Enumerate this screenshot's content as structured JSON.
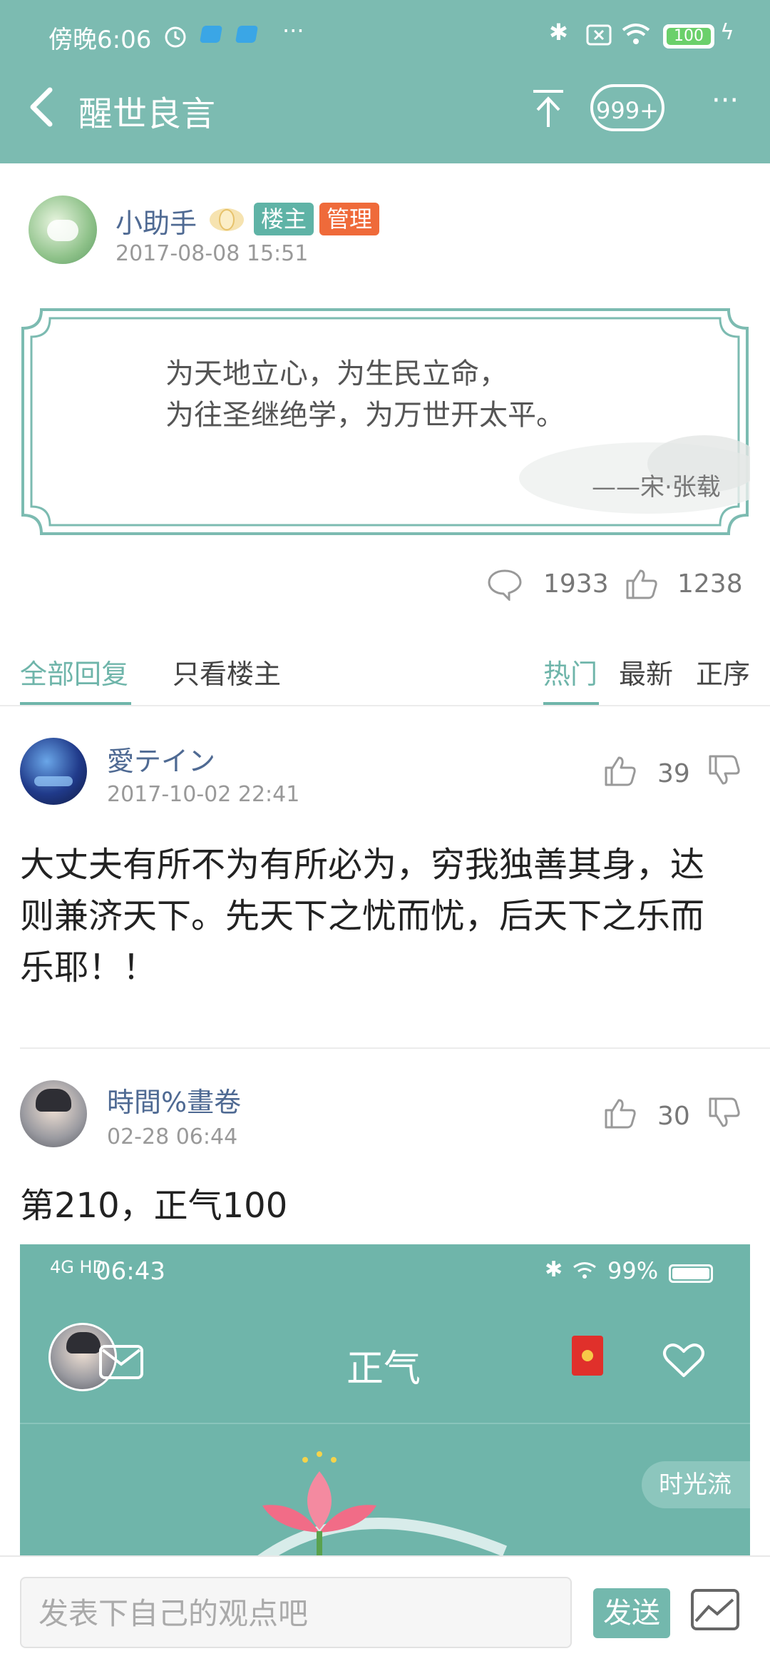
{
  "status_bar": {
    "time": "傍晚6:06",
    "battery": "100",
    "more": "···"
  },
  "header": {
    "title": "醒世良言",
    "bubble_count": "999+",
    "more": "···"
  },
  "post": {
    "author": "小助手",
    "badge_owner": "楼主",
    "badge_admin": "管理",
    "time": "2017-08-08 15:51",
    "quote_line1": "为天地立心，为生民立命，",
    "quote_line2": "为往圣继绝学，为万世开太平。",
    "quote_source": "——宋·张载",
    "comment_count": "1933",
    "like_count": "1238"
  },
  "tabs": {
    "all": "全部回复",
    "owner_only": "只看楼主",
    "hot": "热门",
    "latest": "最新",
    "order": "正序"
  },
  "comments": [
    {
      "author": "愛テイン",
      "time": "2017-10-02 22:41",
      "likes": "39",
      "text_line1": "大丈夫有所不为有所必为，穷我独善其身，达",
      "text_line2": "则兼济天下。先天下之忧而忧，后天下之乐而",
      "text_line3": "乐耶！！"
    },
    {
      "author": "時間%畫卷",
      "time": "02-28 06:44",
      "likes": "30",
      "text_line1": "第210，正气100"
    }
  ],
  "embedded": {
    "network": "4G HD",
    "time": "06:43",
    "battery": "99%",
    "title": "正气",
    "time_flow": "时光流"
  },
  "bottom_bar": {
    "placeholder": "发表下自己的观点吧",
    "send": "发送"
  },
  "colors": {
    "theme": "#7cbbb1",
    "accent": "#6fb5aa",
    "owner_badge": "#5fb3a6",
    "admin_badge": "#ef6a3a",
    "name": "#4f6a93"
  }
}
